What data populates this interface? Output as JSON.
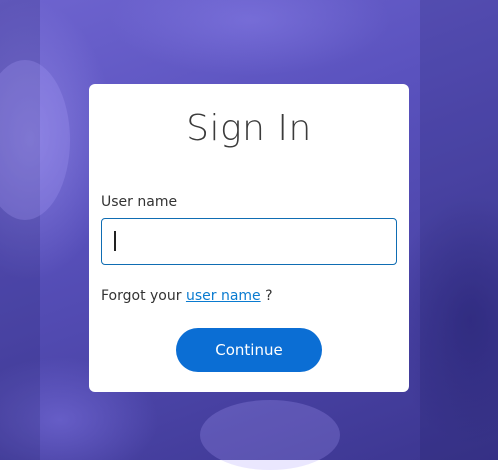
{
  "signin": {
    "title": "Sign In",
    "username_label": "User name",
    "username_value": "",
    "forgot_prefix": "Forgot your",
    "forgot_link": "user name",
    "forgot_suffix": "?",
    "continue_label": "Continue"
  },
  "colors": {
    "primary_button": "#0b6ed4",
    "link": "#0a7bd0",
    "input_border": "#0f6db3",
    "background_tint": "#5a52be"
  }
}
